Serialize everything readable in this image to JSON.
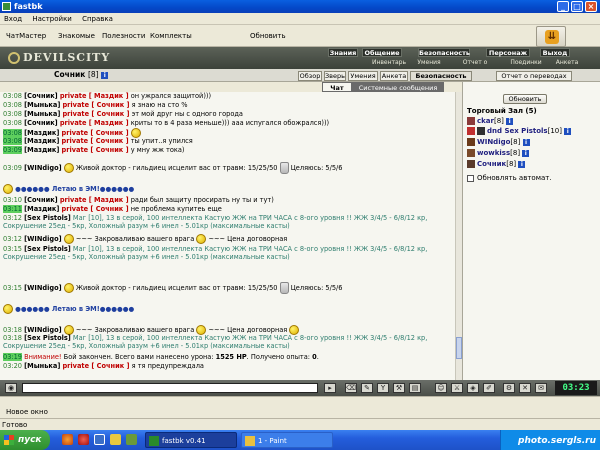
{
  "window": {
    "title": "fastbk"
  },
  "menu": {
    "items": [
      "Вход",
      "Настройки",
      "Справка"
    ]
  },
  "toolbar": {
    "items": [
      "ЧатМастер",
      "Знакомые",
      "Полезности",
      "Комплекты",
      "Обновить"
    ]
  },
  "game_nav": {
    "logo": "DEVILSCITY",
    "tabs": [
      "Знания",
      "Общение",
      "Безопасность",
      "Персонаж",
      "Выход"
    ],
    "sublinks": [
      "Инвентарь",
      "Умения",
      "Отчет о переводах",
      "Поединки",
      "Анкета"
    ]
  },
  "character": {
    "name": "Сочник",
    "level": "[8]",
    "info_icon": "i",
    "tabs": [
      "Обзор",
      "Зверь",
      "Умения",
      "Анкета",
      "Безопасность",
      "Отчет о переводах"
    ]
  },
  "chat_tabs": [
    "Чат",
    "Системные сообщения"
  ],
  "chat": [
    {
      "time": "03:08",
      "nick": "[Сочник]",
      "private": "private [ Маздик ]",
      "text": "он ужрался защитой)))"
    },
    {
      "time": "03:08",
      "nick": "[Мынька]",
      "private": "private [ Сочник ]",
      "text": "я знаю на сто %"
    },
    {
      "time": "03:08",
      "nick": "[Мынька]",
      "private": "private [ Сочник ]",
      "text": "эт мой друг ны с одного города"
    },
    {
      "time": "03:08",
      "nick": "[Сочник]",
      "private": "private [ Маздик ]",
      "text": "криты то в 4 раза меньше))) ааа испугался обожрался)))"
    },
    {
      "time": "03:08",
      "nick": "[Маздик]",
      "private": "private [ Сочник ]",
      "text": ""
    },
    {
      "time": "03:08",
      "nick": "[Маздик]",
      "private": "private [ Сочник ]",
      "text": "ты упит..я упился"
    },
    {
      "time": "03:09",
      "nick": "[Маздик]",
      "private": "private [ Сочник ]",
      "text": "у мну жж тока)"
    },
    {
      "time": "03:09",
      "nick": "[WINdigo]",
      "text": "Живой доктор - гильдиец исцелит вас от травм: 15/25/50",
      "extra": "Целяюсь: 5/5/6"
    },
    {
      "text": "●●●●●● Летаю в ЭМ!●●●●●●"
    },
    {
      "time": "03:10",
      "nick": "[Сочник]",
      "private": "private [ Маздик ]",
      "text": "ради был защиту просирать ну ты и тут)"
    },
    {
      "time": "03:11",
      "nick": "[Маздик]",
      "private": "private [ Сочник ]",
      "text": "не проблема купитеь еще"
    },
    {
      "time": "03:12",
      "nick": "[Sex Pistols]",
      "text": "Маг [10], 13 в серой, 100 интеллекта Кастую ЖЖ на ТРИ ЧАСА с 8-ого уровня !! ЖЖ 3/4/5 - 6/8/12 кр, Сокрушение 25ед - 5кр, Холожный разум +6 инел - 5.01кр (максимальные касты)"
    },
    {
      "time": "03:12",
      "nick": "[WINdigo]",
      "text": "~~~ Закроваливаю вашего врага",
      "extra": "~~~ Цена договорная"
    },
    {
      "time": "03:15",
      "nick": "[Sex Pistols]",
      "text": "Маг [10], 13 в серой, 100 интеллекта Кастую ЖЖ на ТРИ ЧАСА с 8-ого уровня !! ЖЖ 3/4/5 - 6/8/12 кр, Сокрушение 25ед - 5кр, Холожный разум +6 инел - 5.01кр (максимальные касты)"
    },
    {
      "time": "03:15",
      "nick": "[WINdigo]",
      "text": "Живой доктор - гильдиец исцелит вас от травм: 15/25/50",
      "extra": "Целяюсь: 5/5/6"
    },
    {
      "text": "●●●●●● Летаю в ЭМ!●●●●●●"
    },
    {
      "time": "03:18",
      "nick": "[WINdigo]",
      "text": "~~~ Закроваливаю вашего врага",
      "extra": "~~~ Цена договорная"
    },
    {
      "time": "03:18",
      "nick": "[Sex Pistols]",
      "text": "Маг [10], 13 в серой, 100 интеллекта Кастую ЖЖ на ТРИ ЧАСА с 8-ого уровня !! ЖЖ 3/4/5 - 6/8/12 кр, Сокрушение 25ед - 5кр, Холожный разум +6 инел - 5.01кр (максимальные касты)"
    },
    {
      "time": "03:19",
      "warn": "Внимание!",
      "text": "Бой закончен. Всего вами нанесено урона:",
      "hp": "1525 HP",
      "text2": ". Получено опыта:",
      "exp": "0",
      "text3": "."
    },
    {
      "time": "03:20",
      "nick": "[Мынька]",
      "private": "private [ Сочник ]",
      "text": "я тя предупреждала"
    }
  ],
  "room": {
    "update_button": "Обновить",
    "title": "Торговый Зал (5)",
    "users": [
      {
        "name": "ckar",
        "level": "[8]"
      },
      {
        "name": "dnd Sex Pistols",
        "level": "[10]"
      },
      {
        "name": "WINdigo",
        "level": "[8]"
      },
      {
        "name": "wowkiss",
        "level": "[8]"
      },
      {
        "name": "Сочник",
        "level": "[8]"
      }
    ],
    "auto_update": "Обновлять автомат."
  },
  "clock": "03:23",
  "new_window": "Новое окно",
  "status": "Готово",
  "taskbar": {
    "start": "пуск",
    "tasks": [
      "fastbk v0.41",
      "1 - Paint"
    ],
    "watermark": "photo.sergls.ru"
  },
  "colors": {
    "accent": "#0A5FE0",
    "private": "#C00000",
    "time": "#2E7D2E",
    "system": "#2E7D6E"
  }
}
